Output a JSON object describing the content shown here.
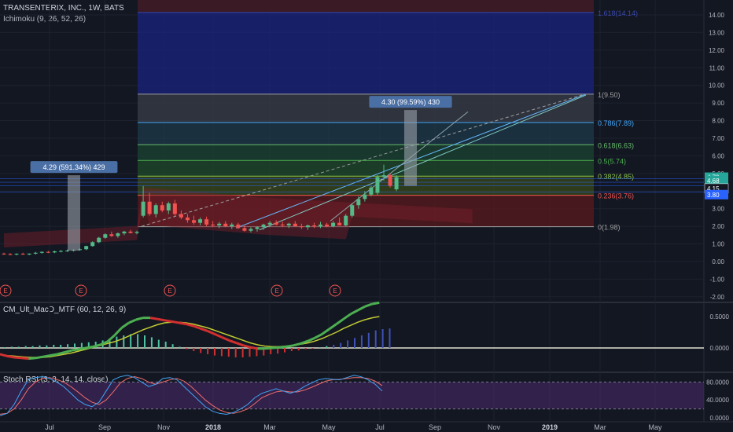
{
  "header": {
    "title": "TRANSENTERIX, INC., 1W, BATS",
    "indicator1": "Ichimoku (9, 26, 52, 26)",
    "indicator2": "CM_Ult_MacD_MTF (60, 12, 26, 9)",
    "indicator3": "Stoch RSI (3, 3, 14, 14, close)"
  },
  "colors": {
    "background": "#131722",
    "grid": "#1e222d",
    "up": "#26a69a",
    "up_bright": "#53b987",
    "down": "#ef5350",
    "fib_blue": "#1a237e",
    "stoch_band": "#4a2a6e",
    "macd_green": "#4caf50",
    "macd_red": "#d32f2f"
  },
  "chart_data": [
    {
      "type": "candlestick",
      "title": "TRANSENTERIX, INC., 1W, BATS",
      "x_tick_labels": [
        "Jul",
        "Sep",
        "Nov",
        "2018",
        "Mar",
        "May",
        "Jul",
        "Sep",
        "Nov",
        "2019",
        "Mar",
        "May"
      ],
      "y_tick_labels": [
        "14.00",
        "13.00",
        "12.00",
        "11.00",
        "10.00",
        "9.00",
        "8.00",
        "7.00",
        "6.00",
        "5.00",
        "4.00",
        "3.00",
        "2.00",
        "1.00",
        "0.00",
        "-1.00",
        "-2.00"
      ],
      "ylim": [
        -2,
        14.5
      ],
      "candles": [
        {
          "o": 0.45,
          "h": 0.5,
          "l": 0.38,
          "c": 0.42
        },
        {
          "o": 0.42,
          "h": 0.48,
          "l": 0.36,
          "c": 0.4
        },
        {
          "o": 0.4,
          "h": 0.47,
          "l": 0.35,
          "c": 0.44
        },
        {
          "o": 0.44,
          "h": 0.5,
          "l": 0.38,
          "c": 0.4
        },
        {
          "o": 0.4,
          "h": 0.46,
          "l": 0.36,
          "c": 0.45
        },
        {
          "o": 0.45,
          "h": 0.55,
          "l": 0.4,
          "c": 0.5
        },
        {
          "o": 0.5,
          "h": 0.58,
          "l": 0.45,
          "c": 0.55
        },
        {
          "o": 0.55,
          "h": 0.6,
          "l": 0.48,
          "c": 0.52
        },
        {
          "o": 0.52,
          "h": 0.62,
          "l": 0.48,
          "c": 0.58
        },
        {
          "o": 0.58,
          "h": 0.65,
          "l": 0.52,
          "c": 0.6
        },
        {
          "o": 0.6,
          "h": 0.68,
          "l": 0.55,
          "c": 0.62
        },
        {
          "o": 0.62,
          "h": 0.7,
          "l": 0.57,
          "c": 0.66
        },
        {
          "o": 0.66,
          "h": 0.75,
          "l": 0.62,
          "c": 0.7
        },
        {
          "o": 0.7,
          "h": 0.9,
          "l": 0.65,
          "c": 0.88
        },
        {
          "o": 0.88,
          "h": 1.15,
          "l": 0.85,
          "c": 1.1
        },
        {
          "o": 1.1,
          "h": 1.4,
          "l": 1.05,
          "c": 1.35
        },
        {
          "o": 1.35,
          "h": 1.6,
          "l": 1.3,
          "c": 1.55
        },
        {
          "o": 1.55,
          "h": 1.7,
          "l": 1.4,
          "c": 1.45
        },
        {
          "o": 1.45,
          "h": 1.65,
          "l": 1.35,
          "c": 1.6
        },
        {
          "o": 1.6,
          "h": 1.75,
          "l": 1.5,
          "c": 1.7
        },
        {
          "o": 1.7,
          "h": 1.8,
          "l": 1.6,
          "c": 1.62
        },
        {
          "o": 1.62,
          "h": 1.75,
          "l": 1.55,
          "c": 1.68
        },
        {
          "o": 2.6,
          "h": 4.29,
          "l": 2.5,
          "c": 3.4
        },
        {
          "o": 3.4,
          "h": 3.9,
          "l": 2.6,
          "c": 2.7
        },
        {
          "o": 2.7,
          "h": 3.3,
          "l": 2.5,
          "c": 3.2
        },
        {
          "o": 3.2,
          "h": 3.4,
          "l": 2.8,
          "c": 2.9
        },
        {
          "o": 2.9,
          "h": 3.4,
          "l": 2.7,
          "c": 3.3
        },
        {
          "o": 3.3,
          "h": 3.5,
          "l": 2.6,
          "c": 2.7
        },
        {
          "o": 2.7,
          "h": 2.9,
          "l": 2.4,
          "c": 2.5
        },
        {
          "o": 2.5,
          "h": 2.7,
          "l": 2.2,
          "c": 2.35
        },
        {
          "o": 2.35,
          "h": 2.6,
          "l": 2.1,
          "c": 2.2
        },
        {
          "o": 2.2,
          "h": 2.5,
          "l": 2.05,
          "c": 2.4
        },
        {
          "o": 2.4,
          "h": 2.55,
          "l": 2.0,
          "c": 2.1
        },
        {
          "o": 2.1,
          "h": 2.3,
          "l": 1.95,
          "c": 2.05
        },
        {
          "o": 2.05,
          "h": 2.25,
          "l": 1.9,
          "c": 2.15
        },
        {
          "o": 2.15,
          "h": 2.3,
          "l": 1.95,
          "c": 2.0
        },
        {
          "o": 2.0,
          "h": 2.2,
          "l": 1.85,
          "c": 2.1
        },
        {
          "o": 2.1,
          "h": 2.2,
          "l": 1.85,
          "c": 1.9
        },
        {
          "o": 1.9,
          "h": 2.05,
          "l": 1.7,
          "c": 1.75
        },
        {
          "o": 1.75,
          "h": 1.95,
          "l": 1.65,
          "c": 1.85
        },
        {
          "o": 1.85,
          "h": 2.0,
          "l": 1.7,
          "c": 1.95
        },
        {
          "o": 1.95,
          "h": 2.15,
          "l": 1.8,
          "c": 2.1
        },
        {
          "o": 2.1,
          "h": 2.3,
          "l": 1.95,
          "c": 2.2
        },
        {
          "o": 2.2,
          "h": 2.35,
          "l": 2.05,
          "c": 2.1
        },
        {
          "o": 2.1,
          "h": 2.25,
          "l": 1.95,
          "c": 2.05
        },
        {
          "o": 2.05,
          "h": 2.2,
          "l": 1.9,
          "c": 2.15
        },
        {
          "o": 2.15,
          "h": 2.3,
          "l": 2.0,
          "c": 2.0
        },
        {
          "o": 2.0,
          "h": 2.15,
          "l": 1.85,
          "c": 1.95
        },
        {
          "o": 1.95,
          "h": 2.1,
          "l": 1.8,
          "c": 2.05
        },
        {
          "o": 2.05,
          "h": 2.2,
          "l": 1.9,
          "c": 2.0
        },
        {
          "o": 2.0,
          "h": 2.25,
          "l": 1.9,
          "c": 2.1
        },
        {
          "o": 2.1,
          "h": 2.2,
          "l": 1.95,
          "c": 2.0
        },
        {
          "o": 2.0,
          "h": 2.3,
          "l": 1.95,
          "c": 2.2
        },
        {
          "o": 2.2,
          "h": 2.5,
          "l": 2.1,
          "c": 2.05
        },
        {
          "o": 2.05,
          "h": 2.7,
          "l": 2.0,
          "c": 2.6
        },
        {
          "o": 2.6,
          "h": 3.3,
          "l": 2.5,
          "c": 3.2
        },
        {
          "o": 3.2,
          "h": 3.7,
          "l": 3.0,
          "c": 3.55
        },
        {
          "o": 3.55,
          "h": 4.0,
          "l": 3.4,
          "c": 3.8
        },
        {
          "o": 3.8,
          "h": 4.3,
          "l": 3.7,
          "c": 4.2
        },
        {
          "o": 3.9,
          "h": 4.9,
          "l": 3.8,
          "c": 4.8
        },
        {
          "o": 4.8,
          "h": 5.5,
          "l": 4.6,
          "c": 4.9
        },
        {
          "o": 4.9,
          "h": 5.0,
          "l": 4.2,
          "c": 4.3
        },
        {
          "o": 4.1,
          "h": 4.9,
          "l": 4.0,
          "c": 4.79
        }
      ],
      "fib_levels": [
        {
          "ratio": "1.618",
          "price": 14.14,
          "label": "1.618(14.14)"
        },
        {
          "ratio": "1",
          "price": 9.5,
          "label": "1(9.50)"
        },
        {
          "ratio": "0.786",
          "price": 7.89,
          "label": "0.786(7.89)"
        },
        {
          "ratio": "0.618",
          "price": 6.63,
          "label": "0.618(6.63)"
        },
        {
          "ratio": "0.5",
          "price": 5.74,
          "label": "0.5(5.74)"
        },
        {
          "ratio": "0.382",
          "price": 4.85,
          "label": "0.382(4.85)"
        },
        {
          "ratio": "0.236",
          "price": 3.76,
          "label": "0.236(3.76)"
        },
        {
          "ratio": "0",
          "price": 1.98,
          "label": "0(1.98)"
        }
      ],
      "annotations": [
        {
          "text": "4.29 (591.34%) 429",
          "from_price": 0.62,
          "to_price": 4.9
        },
        {
          "text": "4.30 (99.59%) 430",
          "from_price": 4.3,
          "to_price": 8.6
        }
      ],
      "price_tags": [
        {
          "text": "4.79",
          "price": 4.79,
          "bg": "#26a69a"
        },
        {
          "text": "4.68",
          "price": 4.6,
          "bg": "#26a69a"
        },
        {
          "text": "4.15",
          "price": 4.15,
          "bg": "#131722"
        },
        {
          "text": "3.80",
          "price": 3.8,
          "bg": "#2962ff"
        }
      ],
      "earnings_markers": [
        "E",
        "E",
        "E",
        "E",
        "E"
      ]
    },
    {
      "type": "bar",
      "title": "CM_Ult_MacD_MTF (60, 12, 26, 9)",
      "y_tick_labels": [
        "0.5000",
        "0.0000"
      ],
      "ylim": [
        -0.25,
        0.7
      ],
      "histogram": [
        0.01,
        0.02,
        0.02,
        0.03,
        0.03,
        0.04,
        0.04,
        0.05,
        0.05,
        0.06,
        0.07,
        0.08,
        0.09,
        0.1,
        0.12,
        0.15,
        0.18,
        0.2,
        0.22,
        0.22,
        0.2,
        0.17,
        0.13,
        0.1,
        0.06,
        0.02,
        -0.02,
        -0.05,
        -0.08,
        -0.1,
        -0.12,
        -0.13,
        -0.14,
        -0.15,
        -0.15,
        -0.14,
        -0.13,
        -0.12,
        -0.1,
        -0.09,
        -0.07,
        -0.05,
        -0.04,
        -0.02,
        -0.01,
        0.01,
        0.03,
        0.05,
        0.08,
        0.12,
        0.16,
        0.2,
        0.24,
        0.28,
        0.3,
        0.31
      ],
      "macd": [
        -0.1,
        -0.13,
        -0.15,
        -0.16,
        -0.17,
        -0.16,
        -0.14,
        -0.12,
        -0.1,
        -0.07,
        -0.04,
        -0.02,
        0.0,
        0.02,
        0.05,
        0.1,
        0.2,
        0.32,
        0.4,
        0.45,
        0.48,
        0.48,
        0.46,
        0.44,
        0.42,
        0.4,
        0.38,
        0.35,
        0.31,
        0.27,
        0.22,
        0.17,
        0.12,
        0.08,
        0.04,
        0.01,
        -0.01,
        -0.01,
        0.0,
        0.01,
        0.02,
        0.04,
        0.07,
        0.11,
        0.16,
        0.22,
        0.3,
        0.38,
        0.46,
        0.54,
        0.6,
        0.66,
        0.7,
        0.72
      ],
      "signal": [
        -0.1,
        -0.12,
        -0.13,
        -0.14,
        -0.15,
        -0.15,
        -0.15,
        -0.14,
        -0.12,
        -0.1,
        -0.08,
        -0.05,
        -0.02,
        0.01,
        0.04,
        0.07,
        0.1,
        0.14,
        0.19,
        0.24,
        0.29,
        0.33,
        0.37,
        0.4,
        0.41,
        0.41,
        0.4,
        0.38,
        0.35,
        0.32,
        0.28,
        0.24,
        0.2,
        0.16,
        0.12,
        0.08,
        0.05,
        0.03,
        0.02,
        0.02,
        0.03,
        0.04,
        0.06,
        0.08,
        0.11,
        0.15,
        0.2,
        0.25,
        0.31,
        0.36,
        0.41,
        0.45,
        0.48,
        0.5
      ]
    },
    {
      "type": "line",
      "title": "Stoch RSI (3, 3, 14, 14, close)",
      "y_tick_labels": [
        "80.0000",
        "40.0000",
        "0.0000"
      ],
      "ylim": [
        0,
        100
      ],
      "k": [
        5,
        10,
        30,
        60,
        85,
        90,
        92,
        88,
        80,
        70,
        55,
        40,
        30,
        25,
        35,
        60,
        85,
        92,
        95,
        90,
        80,
        70,
        75,
        88,
        90,
        85,
        70,
        55,
        40,
        25,
        15,
        10,
        8,
        12,
        20,
        30,
        45,
        55,
        60,
        65,
        60,
        55,
        60,
        70,
        78,
        85,
        88,
        86,
        85,
        90,
        95,
        92,
        85,
        75,
        60
      ],
      "d": [
        8,
        10,
        20,
        40,
        65,
        80,
        88,
        90,
        86,
        80,
        70,
        58,
        45,
        35,
        30,
        40,
        58,
        78,
        88,
        92,
        88,
        80,
        75,
        80,
        85,
        88,
        82,
        70,
        55,
        40,
        28,
        18,
        12,
        10,
        14,
        20,
        32,
        45,
        52,
        58,
        60,
        58,
        58,
        62,
        68,
        75,
        82,
        85,
        86,
        88,
        90,
        90,
        88,
        82,
        72
      ]
    }
  ]
}
